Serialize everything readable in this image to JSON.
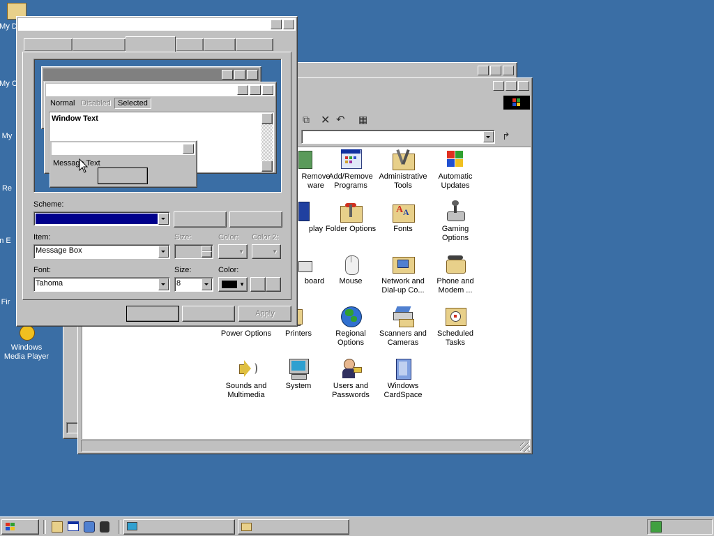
{
  "desktop": {
    "icons": [
      {
        "label": "My D"
      },
      {
        "label": "My C"
      },
      {
        "label": "My"
      },
      {
        "label": "Re"
      },
      {
        "label": "In E"
      },
      {
        "label": "Fir"
      },
      {
        "label": "Windows Media Player"
      }
    ]
  },
  "control_panel": {
    "icons": [
      {
        "label": "Remove ware",
        "icon": "add-remove-software-icon"
      },
      {
        "label": "Add/Remove Programs",
        "icon": "add-remove-programs-icon"
      },
      {
        "label": "Administrative Tools",
        "icon": "administrative-tools-icon"
      },
      {
        "label": "Automatic Updates",
        "icon": "automatic-updates-icon"
      },
      {
        "label": "play",
        "icon": "display-icon"
      },
      {
        "label": "Folder Options",
        "icon": "folder-options-icon"
      },
      {
        "label": "Fonts",
        "icon": "fonts-icon"
      },
      {
        "label": "Gaming Options",
        "icon": "gaming-options-icon"
      },
      {
        "label": "board",
        "icon": "keyboard-icon"
      },
      {
        "label": "Mouse",
        "icon": "mouse-icon"
      },
      {
        "label": "Network and Dial-up Co...",
        "icon": "network-icon"
      },
      {
        "label": "Phone and Modem ...",
        "icon": "phone-modem-icon"
      },
      {
        "label": "Power Options",
        "icon": "power-options-icon"
      },
      {
        "label": "Printers",
        "icon": "printers-icon"
      },
      {
        "label": "Regional Options",
        "icon": "regional-options-icon"
      },
      {
        "label": "Scanners and Cameras",
        "icon": "scanners-cameras-icon"
      },
      {
        "label": "Scheduled Tasks",
        "icon": "scheduled-tasks-icon"
      },
      {
        "label": "Sounds and Multimedia",
        "icon": "sounds-icon"
      },
      {
        "label": "System",
        "icon": "system-icon"
      },
      {
        "label": "Users and Passwords",
        "icon": "users-icon"
      },
      {
        "label": "Windows CardSpace",
        "icon": "cardspace-icon"
      }
    ]
  },
  "display_dialog": {
    "preview": {
      "tab_normal": "Normal",
      "tab_disabled": "Disabled",
      "tab_selected": "Selected",
      "window_text": "Window Text",
      "message_text": "Message Text"
    },
    "scheme_label": "Scheme:",
    "item_label": "Item:",
    "item_value": "Message Box",
    "size_label_disabled": "Size:",
    "color_label_disabled": "Color:",
    "color2_label_disabled": "Color 2:",
    "font_label": "Font:",
    "font_value": "Tahoma",
    "font_size_label": "Size:",
    "font_size_value": "8",
    "font_color_label": "Color:",
    "apply_label": "Apply",
    "colors": {
      "scheme_fill": "#00008b",
      "preview_bg": "#3a6ea5",
      "desktop_bg": "#3a6ea5"
    }
  }
}
